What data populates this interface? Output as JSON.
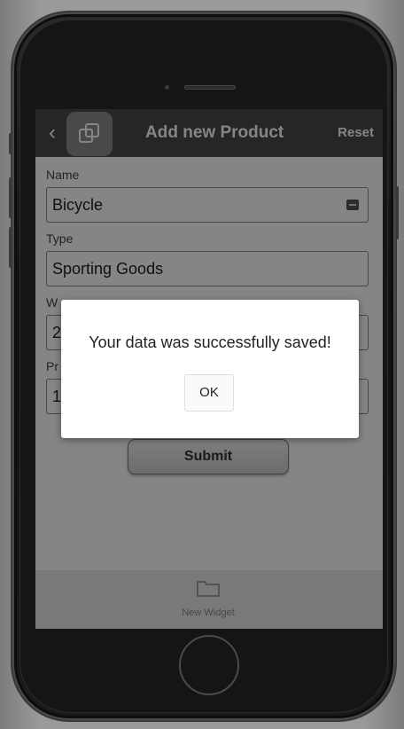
{
  "header": {
    "title": "Add new Product",
    "back_icon": "chevron-left-icon",
    "app_icon": "layers-icon",
    "reset_label": "Reset"
  },
  "form": {
    "name_label": "Name",
    "name_value": "Bicycle",
    "type_label": "Type",
    "type_value": "Sporting Goods",
    "field3_label": "W",
    "field3_value": "24",
    "field4_label": "Pr",
    "field4_value": "11"
  },
  "submit_label": "Submit",
  "tabbar": {
    "items": [
      {
        "icon": "folder-icon",
        "label": "New Widget"
      }
    ]
  },
  "dialog": {
    "message": "Your data was successfully saved!",
    "ok_label": "OK"
  },
  "colors": {
    "topbar": "#4a4a4a",
    "app_icon_bg": "#8c8c8c",
    "overlay": "rgba(0,0,0,0.48)"
  }
}
